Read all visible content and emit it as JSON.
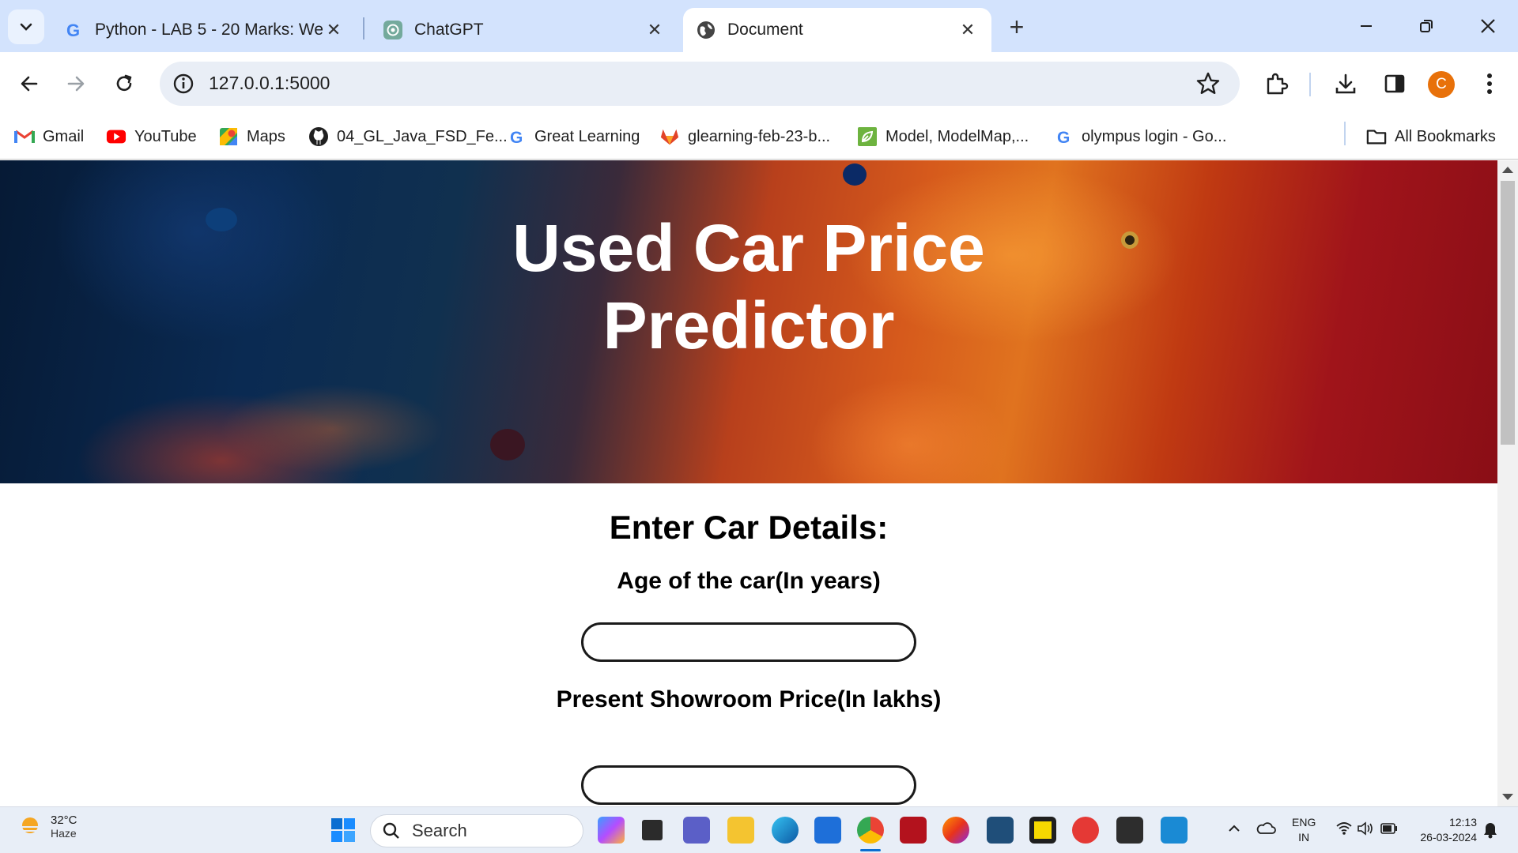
{
  "browser": {
    "tabs": [
      {
        "title": "Python - LAB 5 - 20 Marks: Web",
        "favicon": "google-icon",
        "active": false
      },
      {
        "title": "ChatGPT",
        "favicon": "chatgpt-icon",
        "active": false
      },
      {
        "title": "Document",
        "favicon": "globe-icon",
        "active": true
      }
    ],
    "url": "127.0.0.1:5000",
    "avatar_letter": "C",
    "accent": "#d3e3fd",
    "avatar_color": "#e8710a"
  },
  "bookmarks": [
    {
      "label": "Gmail",
      "icon": "gmail-icon"
    },
    {
      "label": "YouTube",
      "icon": "youtube-icon"
    },
    {
      "label": "Maps",
      "icon": "maps-icon"
    },
    {
      "label": "04_GL_Java_FSD_Fe...",
      "icon": "github-icon"
    },
    {
      "label": "Great Learning",
      "icon": "google-icon"
    },
    {
      "label": "glearning-feb-23-b...",
      "icon": "gitlab-icon"
    },
    {
      "label": "Model, ModelMap,...",
      "icon": "leaf-icon"
    },
    {
      "label": "olympus login - Go...",
      "icon": "google-icon"
    }
  ],
  "all_bookmarks_label": "All Bookmarks",
  "page": {
    "title": "Used Car Price Predictor",
    "form_heading": "Enter Car Details:",
    "fields": [
      {
        "label": "Age of the car(In years)",
        "value": ""
      },
      {
        "label": "Present Showroom Price(In lakhs)",
        "value": ""
      }
    ]
  },
  "taskbar": {
    "weather_temp": "32°C",
    "weather_condition": "Haze",
    "search_placeholder": "Search",
    "language_line1": "ENG",
    "language_line2": "IN",
    "time": "12:13",
    "date": "26-03-2024"
  }
}
